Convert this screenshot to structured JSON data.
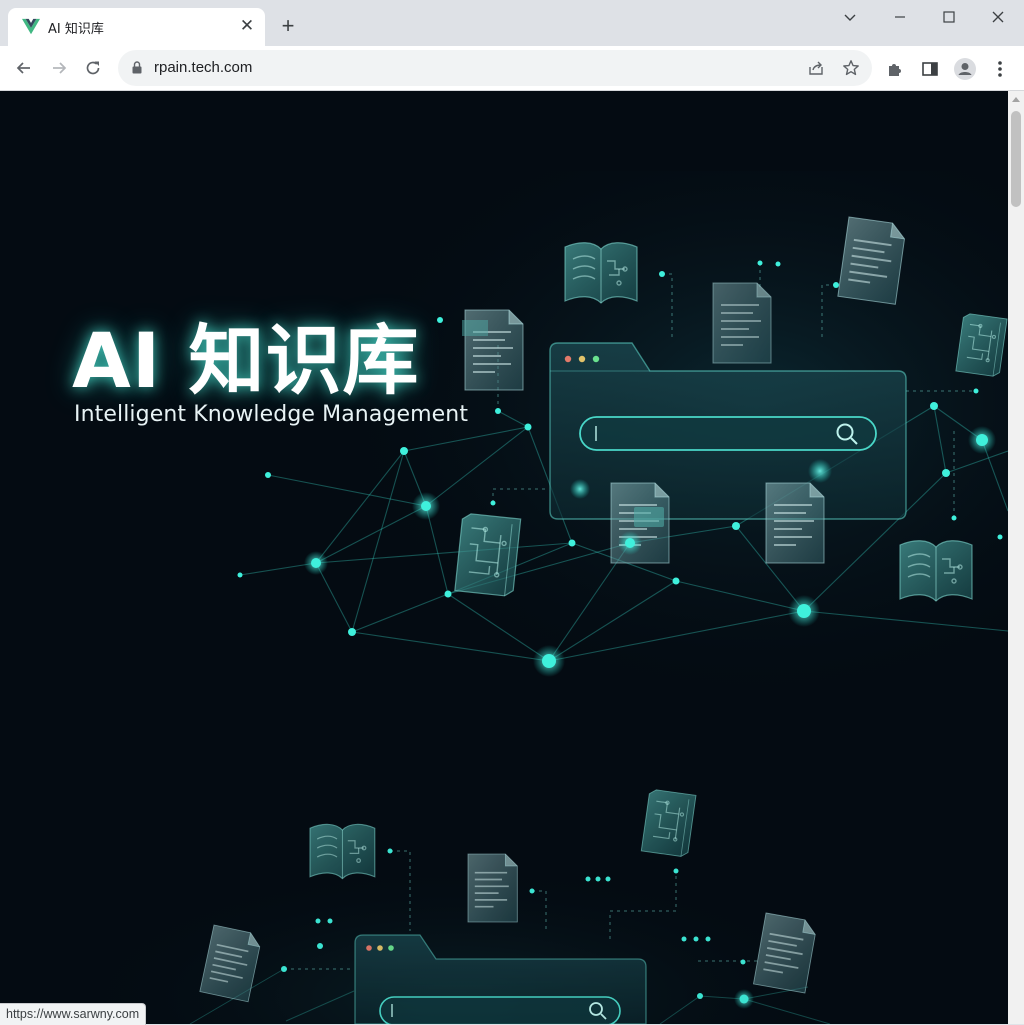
{
  "browser": {
    "tab_title": "AI 知识库",
    "url": "rpain.tech.com",
    "status_url": "https://www.sarwny.com",
    "accent": "#1dd3c4"
  },
  "icons": {
    "favicon": "vue-logo-icon",
    "back": "arrow-left-icon",
    "forward": "arrow-right-icon",
    "reload": "reload-icon",
    "lock": "lock-icon",
    "share": "share-icon",
    "bookmark": "star-icon",
    "extensions": "puzzle-icon",
    "side_panel": "side-panel-icon",
    "profile": "avatar-icon",
    "menu": "kebab-menu-icon"
  },
  "hero": {
    "title": "AI 知识库",
    "subtitle": "Intelligent Knowledge Management"
  }
}
